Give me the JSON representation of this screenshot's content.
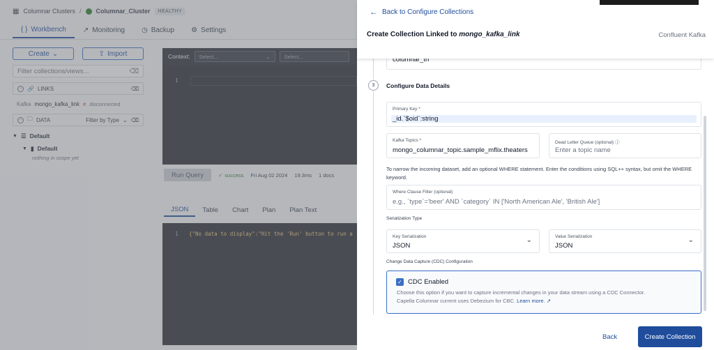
{
  "breadcrumb": {
    "root": "Columnar Clusters",
    "separator": "/",
    "cluster": "Columnar_Cluster",
    "status": "HEALTHY"
  },
  "top_tabs": [
    {
      "label": "Workbench",
      "icon": "code-braces-icon"
    },
    {
      "label": "Monitoring",
      "icon": "chart-icon"
    },
    {
      "label": "Backup",
      "icon": "clock-icon"
    },
    {
      "label": "Settings",
      "icon": "gear-icon"
    }
  ],
  "sidebar": {
    "create_label": "Create",
    "import_label": "Import",
    "filter_placeholder": "Filter collections/views...",
    "links_title": "LINKS",
    "link": {
      "type": "Kafka",
      "name": "mongo_kafka_link",
      "status": "disconnected"
    },
    "data_title": "DATA",
    "data_filter": "Filter by Type",
    "tree": {
      "database": "Default",
      "scope": "Default",
      "empty": "nothing in scope yet"
    }
  },
  "editor": {
    "context_label": "Context:",
    "select1": "Select...",
    "select2": "Select...",
    "line": "1"
  },
  "run": {
    "button": "Run Query",
    "status": "success",
    "date": "Fri Aug 02 2024",
    "time": "19.3ms",
    "docs": "1 docs"
  },
  "result_tabs": [
    "JSON",
    "Table",
    "Chart",
    "Plan",
    "Plan Text"
  ],
  "result": {
    "line": "1",
    "code": "{\"No data to display\":\"Hit the 'Run' button to run a"
  },
  "drawer": {
    "back_label": "Back to Configure Collections",
    "title_prefix": "Create Collection Linked to",
    "title_link": "mongo_kafka_link",
    "subtitle": "Confluent Kafka",
    "top_field_value": "columnar_th",
    "step_number": "3",
    "step_title": "Configure Data Details",
    "primary_key": {
      "label": "Primary Key *",
      "value": "_id.`$oid`:string"
    },
    "kafka_topics": {
      "label": "Kafka Topics *",
      "value": "mongo_columnar_topic.sample_mflix.theaters"
    },
    "dead_letter": {
      "label": "Dead Letter Queue (optional) ⓘ",
      "placeholder": "Enter a topic name"
    },
    "where_note": "To narrow the incoming dataset, add an optional WHERE statement. Enter the conditions using SQL++ syntax, but omit the WHERE keyword.",
    "where_filter": {
      "label": "Where Clause Filter (optional)",
      "placeholder": "e.g., `type`='beer' AND `category` IN ['North American Ale', 'British Ale']"
    },
    "serialization_title": "Serialization Type",
    "key_serialization": {
      "label": "Key Serialization",
      "value": "JSON"
    },
    "value_serialization": {
      "label": "Value Serialization",
      "value": "JSON"
    },
    "cdc_section_title": "Change Data Capture (CDC) Configuration",
    "cdc": {
      "title": "CDC Enabled",
      "checked": true,
      "desc1": "Choose this option if you want to capture incremental changes in your data stream using a CDC Connector.",
      "desc2": "Capella Columnar current uses Debezium for CBC.",
      "learn_more": "Learn more."
    },
    "back_button": "Back",
    "create_button": "Create Collection"
  },
  "colors": {
    "accent": "#1f4d9c",
    "success": "#2e7d32",
    "editor_bg": "#2b2f35"
  }
}
